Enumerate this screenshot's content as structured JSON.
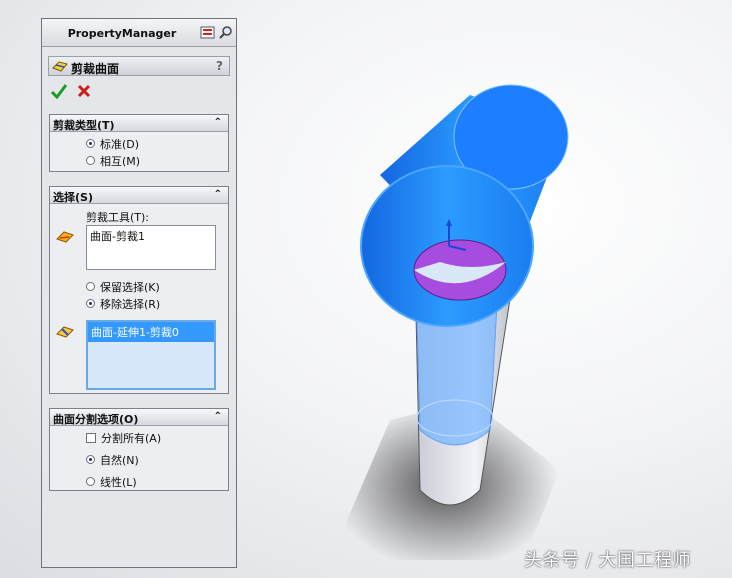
{
  "property_manager": {
    "title": "PropertyManager",
    "feature_name": "剪裁曲面",
    "help_label": "?",
    "trim_type": {
      "title": "剪裁类型(T)",
      "options": [
        {
          "label": "标准(D)",
          "selected": true
        },
        {
          "label": "相互(M)",
          "selected": false
        }
      ]
    },
    "selections": {
      "title": "选择(S)",
      "trim_tool_label": "剪裁工具(T):",
      "trim_tool_value": "曲面-剪裁1",
      "keep_option": {
        "label": "保留选择(K)",
        "selected": false
      },
      "remove_option": {
        "label": "移除选择(R)",
        "selected": true
      },
      "selected_item": "曲面-延伸1-剪裁0"
    },
    "split_options": {
      "title": "曲面分割选项(O)",
      "split_all": {
        "label": "分割所有(A)",
        "checked": false
      },
      "natural": {
        "label": "自然(N)",
        "selected": true
      },
      "linear": {
        "label": "线性(L)",
        "selected": false
      }
    }
  },
  "colors": {
    "surface_blue": "#1e8cff",
    "cut_face_purple": "#a64de0",
    "panel_bg": "#e4e6ea"
  },
  "watermark": "头条号 / 大国工程师"
}
